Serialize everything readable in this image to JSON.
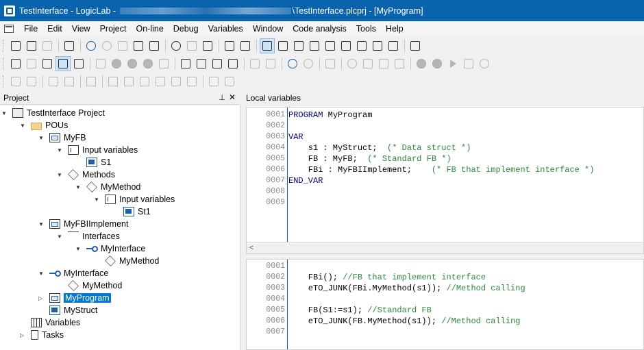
{
  "window": {
    "title_prefix": "TestInterface - LogicLab - ",
    "title_suffix": "\\TestInterface.plcprj - [MyProgram]"
  },
  "menu": [
    "File",
    "Edit",
    "View",
    "Project",
    "On-line",
    "Debug",
    "Variables",
    "Window",
    "Code analysis",
    "Tools",
    "Help"
  ],
  "project_panel": {
    "title": "Project",
    "pin": "⊥",
    "close": "✕",
    "tree": [
      {
        "label": "TestInterface Project",
        "icon": "project-icon",
        "depth": 0,
        "toggle": "▼"
      },
      {
        "label": "POUs",
        "icon": "folder-icon",
        "depth": 1,
        "toggle": "▼"
      },
      {
        "label": "MyFB",
        "icon": "function-block-icon",
        "depth": 2,
        "toggle": "▼"
      },
      {
        "label": "Input variables",
        "icon": "variables-icon",
        "depth": 3,
        "toggle": "▼"
      },
      {
        "label": "S1",
        "icon": "struct-icon",
        "depth": 4,
        "toggle": ""
      },
      {
        "label": "Methods",
        "icon": "method-icon",
        "depth": 3,
        "toggle": "▼"
      },
      {
        "label": "MyMethod",
        "icon": "method-icon",
        "depth": 4,
        "toggle": "▼"
      },
      {
        "label": "Input variables",
        "icon": "variables-icon",
        "depth": 5,
        "toggle": "▼"
      },
      {
        "label": "St1",
        "icon": "struct-icon",
        "depth": 6,
        "toggle": ""
      },
      {
        "label": "MyFBIImplement",
        "icon": "function-block-icon",
        "depth": 2,
        "toggle": "▼"
      },
      {
        "label": "Interfaces",
        "icon": "hierarchy-icon",
        "depth": 3,
        "toggle": "▼"
      },
      {
        "label": "MyInterface",
        "icon": "interface-icon",
        "depth": 4,
        "toggle": "▼"
      },
      {
        "label": "MyMethod",
        "icon": "method-icon",
        "depth": 5,
        "toggle": ""
      },
      {
        "label": "MyInterface",
        "icon": "interface-icon",
        "depth": 2,
        "toggle": "▼"
      },
      {
        "label": "MyMethod",
        "icon": "method-icon",
        "depth": 3,
        "toggle": ""
      },
      {
        "label": "MyProgram",
        "icon": "program-icon",
        "depth": 2,
        "toggle": "▷",
        "selected": true
      },
      {
        "label": "MyStruct",
        "icon": "struct-icon",
        "depth": 2,
        "toggle": ""
      },
      {
        "label": "Variables",
        "icon": "global-variables-icon",
        "depth": 1,
        "toggle": ""
      },
      {
        "label": "Tasks",
        "icon": "tasks-icon",
        "depth": 1,
        "toggle": "▷"
      }
    ]
  },
  "local_variables": {
    "title": "Local variables",
    "lines": [
      {
        "n": "0001",
        "text": "PROGRAM MyProgram"
      },
      {
        "n": "0002",
        "text": ""
      },
      {
        "n": "0003",
        "text": "VAR"
      },
      {
        "n": "0004",
        "text": "    s1 : MyStruct;  (* Data struct *)"
      },
      {
        "n": "0005",
        "text": "    FB : MyFB;  (* Standard FB *)"
      },
      {
        "n": "0006",
        "text": "    FBi : MyFBIImplement;    (* FB that implement interface *)"
      },
      {
        "n": "0007",
        "text": "END_VAR"
      },
      {
        "n": "0008",
        "text": ""
      },
      {
        "n": "0009",
        "text": ""
      }
    ],
    "scroll_left": "<"
  },
  "code_editor": {
    "lines": [
      {
        "n": "0001",
        "text": ""
      },
      {
        "n": "0002",
        "text": "    FBi(); //FB that implement interface"
      },
      {
        "n": "0003",
        "text": "    eTO_JUNK(FBi.MyMethod(s1)); //Method calling"
      },
      {
        "n": "0004",
        "text": ""
      },
      {
        "n": "0005",
        "text": "    FB(S1:=s1); //Standard FB"
      },
      {
        "n": "0006",
        "text": "    eTO_JUNK(FB.MyMethod(s1)); //Method calling"
      },
      {
        "n": "0007",
        "text": ""
      }
    ]
  }
}
